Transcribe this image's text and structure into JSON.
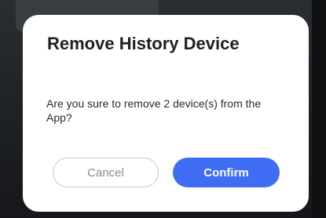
{
  "dialog": {
    "title": "Remove History Device",
    "message": "Are you sure to remove 2 device(s) from the App?",
    "cancel_label": "Cancel",
    "confirm_label": "Confirm"
  },
  "colors": {
    "accent": "#3f6ef5",
    "dialog_background": "#ffffff",
    "overlay": "#1b1e22"
  }
}
